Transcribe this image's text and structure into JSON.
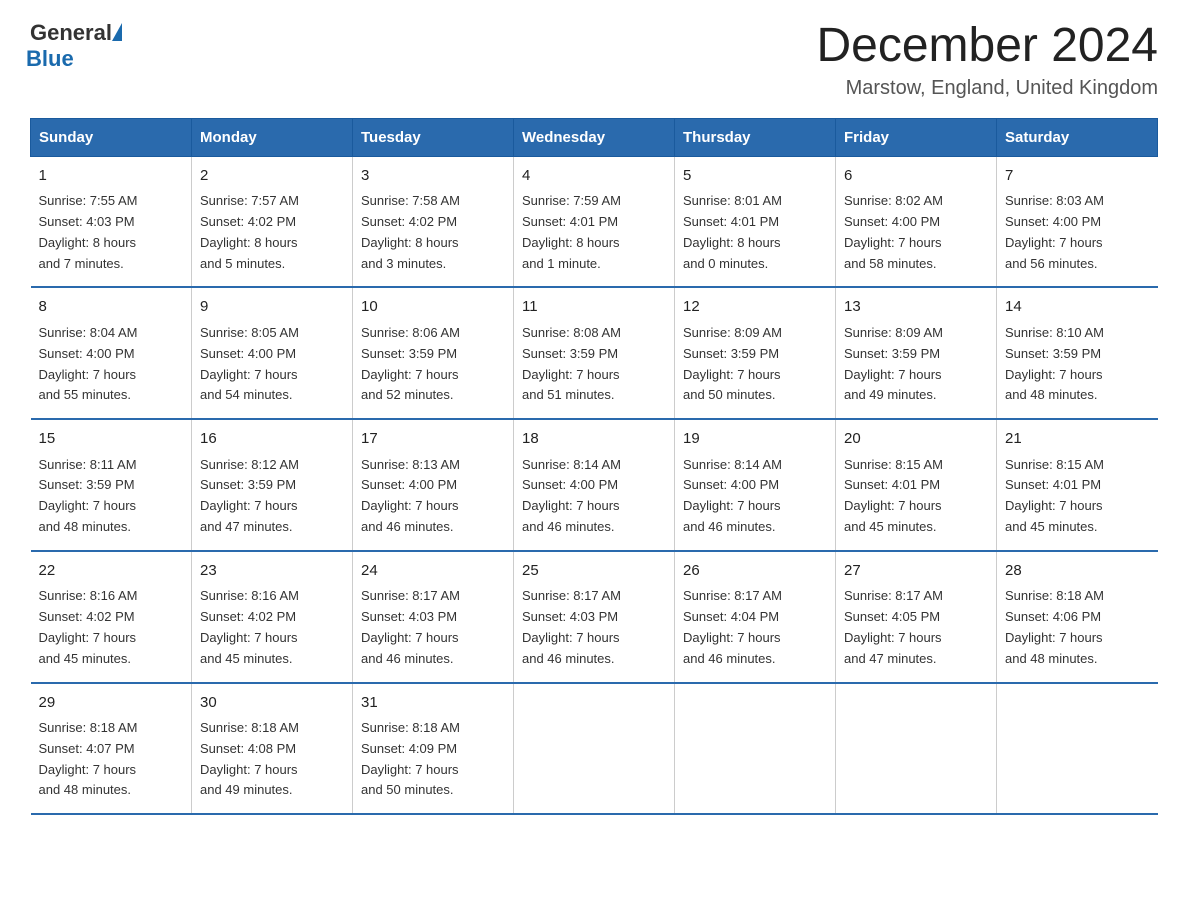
{
  "header": {
    "logo_general": "General",
    "logo_blue": "Blue",
    "month_title": "December 2024",
    "location": "Marstow, England, United Kingdom"
  },
  "days_of_week": [
    "Sunday",
    "Monday",
    "Tuesday",
    "Wednesday",
    "Thursday",
    "Friday",
    "Saturday"
  ],
  "weeks": [
    [
      {
        "day": "1",
        "sunrise": "7:55 AM",
        "sunset": "4:03 PM",
        "daylight": "8 hours and 7 minutes."
      },
      {
        "day": "2",
        "sunrise": "7:57 AM",
        "sunset": "4:02 PM",
        "daylight": "8 hours and 5 minutes."
      },
      {
        "day": "3",
        "sunrise": "7:58 AM",
        "sunset": "4:02 PM",
        "daylight": "8 hours and 3 minutes."
      },
      {
        "day": "4",
        "sunrise": "7:59 AM",
        "sunset": "4:01 PM",
        "daylight": "8 hours and 1 minute."
      },
      {
        "day": "5",
        "sunrise": "8:01 AM",
        "sunset": "4:01 PM",
        "daylight": "8 hours and 0 minutes."
      },
      {
        "day": "6",
        "sunrise": "8:02 AM",
        "sunset": "4:00 PM",
        "daylight": "7 hours and 58 minutes."
      },
      {
        "day": "7",
        "sunrise": "8:03 AM",
        "sunset": "4:00 PM",
        "daylight": "7 hours and 56 minutes."
      }
    ],
    [
      {
        "day": "8",
        "sunrise": "8:04 AM",
        "sunset": "4:00 PM",
        "daylight": "7 hours and 55 minutes."
      },
      {
        "day": "9",
        "sunrise": "8:05 AM",
        "sunset": "4:00 PM",
        "daylight": "7 hours and 54 minutes."
      },
      {
        "day": "10",
        "sunrise": "8:06 AM",
        "sunset": "3:59 PM",
        "daylight": "7 hours and 52 minutes."
      },
      {
        "day": "11",
        "sunrise": "8:08 AM",
        "sunset": "3:59 PM",
        "daylight": "7 hours and 51 minutes."
      },
      {
        "day": "12",
        "sunrise": "8:09 AM",
        "sunset": "3:59 PM",
        "daylight": "7 hours and 50 minutes."
      },
      {
        "day": "13",
        "sunrise": "8:09 AM",
        "sunset": "3:59 PM",
        "daylight": "7 hours and 49 minutes."
      },
      {
        "day": "14",
        "sunrise": "8:10 AM",
        "sunset": "3:59 PM",
        "daylight": "7 hours and 48 minutes."
      }
    ],
    [
      {
        "day": "15",
        "sunrise": "8:11 AM",
        "sunset": "3:59 PM",
        "daylight": "7 hours and 48 minutes."
      },
      {
        "day": "16",
        "sunrise": "8:12 AM",
        "sunset": "3:59 PM",
        "daylight": "7 hours and 47 minutes."
      },
      {
        "day": "17",
        "sunrise": "8:13 AM",
        "sunset": "4:00 PM",
        "daylight": "7 hours and 46 minutes."
      },
      {
        "day": "18",
        "sunrise": "8:14 AM",
        "sunset": "4:00 PM",
        "daylight": "7 hours and 46 minutes."
      },
      {
        "day": "19",
        "sunrise": "8:14 AM",
        "sunset": "4:00 PM",
        "daylight": "7 hours and 46 minutes."
      },
      {
        "day": "20",
        "sunrise": "8:15 AM",
        "sunset": "4:01 PM",
        "daylight": "7 hours and 45 minutes."
      },
      {
        "day": "21",
        "sunrise": "8:15 AM",
        "sunset": "4:01 PM",
        "daylight": "7 hours and 45 minutes."
      }
    ],
    [
      {
        "day": "22",
        "sunrise": "8:16 AM",
        "sunset": "4:02 PM",
        "daylight": "7 hours and 45 minutes."
      },
      {
        "day": "23",
        "sunrise": "8:16 AM",
        "sunset": "4:02 PM",
        "daylight": "7 hours and 45 minutes."
      },
      {
        "day": "24",
        "sunrise": "8:17 AM",
        "sunset": "4:03 PM",
        "daylight": "7 hours and 46 minutes."
      },
      {
        "day": "25",
        "sunrise": "8:17 AM",
        "sunset": "4:03 PM",
        "daylight": "7 hours and 46 minutes."
      },
      {
        "day": "26",
        "sunrise": "8:17 AM",
        "sunset": "4:04 PM",
        "daylight": "7 hours and 46 minutes."
      },
      {
        "day": "27",
        "sunrise": "8:17 AM",
        "sunset": "4:05 PM",
        "daylight": "7 hours and 47 minutes."
      },
      {
        "day": "28",
        "sunrise": "8:18 AM",
        "sunset": "4:06 PM",
        "daylight": "7 hours and 48 minutes."
      }
    ],
    [
      {
        "day": "29",
        "sunrise": "8:18 AM",
        "sunset": "4:07 PM",
        "daylight": "7 hours and 48 minutes."
      },
      {
        "day": "30",
        "sunrise": "8:18 AM",
        "sunset": "4:08 PM",
        "daylight": "7 hours and 49 minutes."
      },
      {
        "day": "31",
        "sunrise": "8:18 AM",
        "sunset": "4:09 PM",
        "daylight": "7 hours and 50 minutes."
      },
      null,
      null,
      null,
      null
    ]
  ],
  "labels": {
    "sunrise": "Sunrise:",
    "sunset": "Sunset:",
    "daylight": "Daylight:"
  }
}
